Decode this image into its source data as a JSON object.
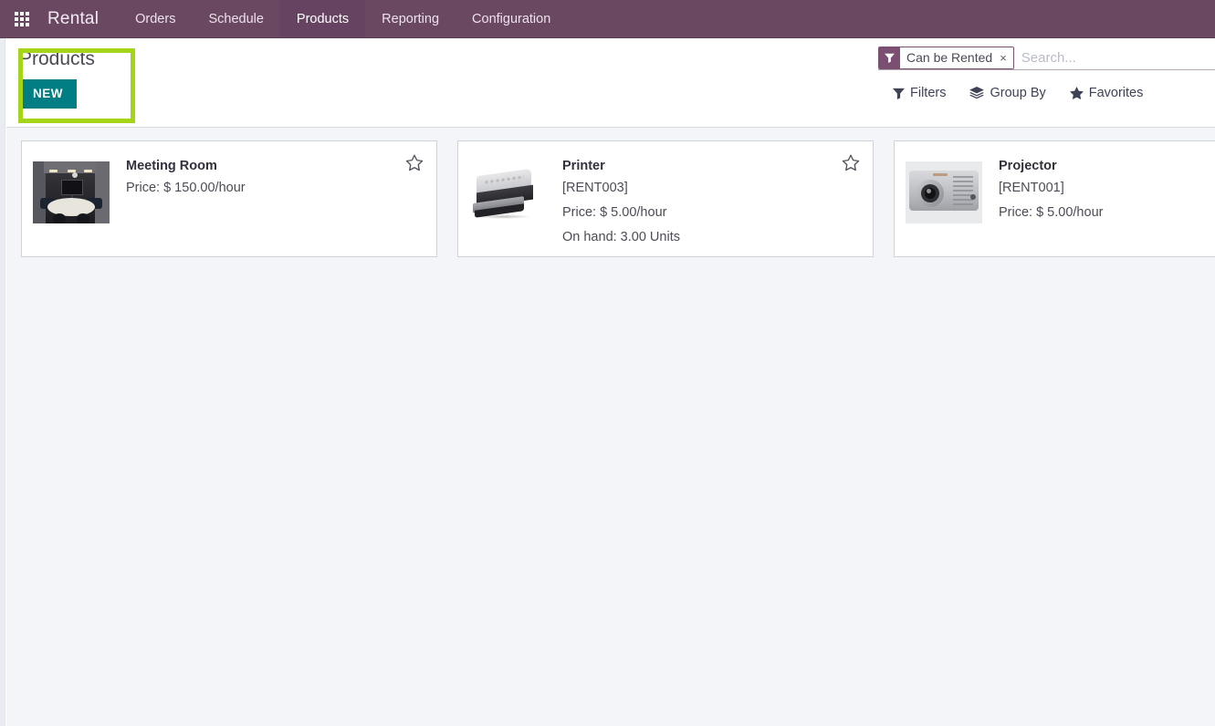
{
  "navbar": {
    "apps_icon": "apps-grid-icon",
    "brand": "Rental",
    "items": [
      {
        "label": "Orders",
        "active": false
      },
      {
        "label": "Schedule",
        "active": false
      },
      {
        "label": "Products",
        "active": true
      },
      {
        "label": "Reporting",
        "active": false
      },
      {
        "label": "Configuration",
        "active": false
      }
    ]
  },
  "control_panel": {
    "page_title": "Products",
    "new_button": "NEW",
    "annotation_color": "#a5d518"
  },
  "search": {
    "facet": {
      "icon": "filter-funnel-icon",
      "label": "Can be Rented",
      "remove": "×"
    },
    "placeholder": "Search...",
    "value": "",
    "tools": [
      {
        "label": "Filters",
        "icon": "filter-funnel-icon"
      },
      {
        "label": "Group By",
        "icon": "layers-icon"
      },
      {
        "label": "Favorites",
        "icon": "star-filled-icon"
      }
    ]
  },
  "kanban": {
    "cards": [
      {
        "title": "Meeting Room",
        "reference": "",
        "price": "Price: $ 150.00/hour",
        "on_hand": "",
        "thumb": "meeting-room-photo",
        "star": "star-outline-icon"
      },
      {
        "title": "Printer",
        "reference": "[RENT003]",
        "price": "Price: $ 5.00/hour",
        "on_hand": "On hand: 3.00 Units",
        "thumb": "printer-photo",
        "star": "star-outline-icon"
      },
      {
        "title": "Projector",
        "reference": "[RENT001]",
        "price": "Price: $ 5.00/hour",
        "on_hand": "",
        "thumb": "projector-photo",
        "star": "star-outline-icon"
      }
    ]
  },
  "theme": {
    "navbar_bg": "#6b4862",
    "navbar_active_bg": "#664461",
    "new_button_bg": "#017e84",
    "facet_accent": "#7b4f72",
    "content_bg": "#f4f5f9"
  }
}
